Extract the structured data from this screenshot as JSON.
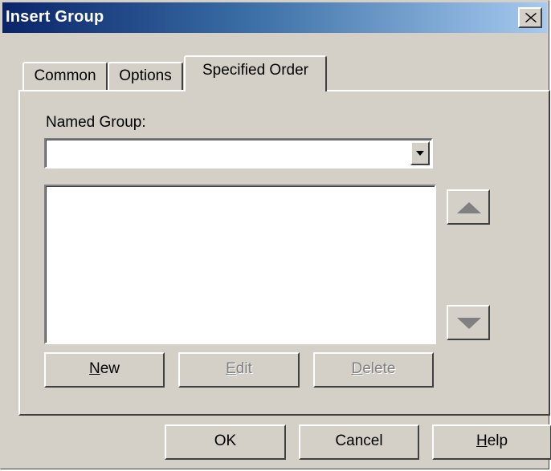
{
  "window": {
    "title": "Insert Group"
  },
  "tabs": [
    {
      "label": "Common",
      "active": false
    },
    {
      "label": "Options",
      "active": false
    },
    {
      "label": "Specified Order",
      "active": true
    }
  ],
  "specified_order": {
    "named_group_label": "Named Group:",
    "named_group_value": "",
    "list_items": [],
    "buttons": {
      "new": {
        "label": "New",
        "mnemonic": "N",
        "rest": "ew",
        "enabled": true
      },
      "edit": {
        "label": "Edit",
        "mnemonic": "E",
        "rest": "dit",
        "enabled": false
      },
      "delete": {
        "label": "Delete",
        "mnemonic": "D",
        "rest": "elete",
        "enabled": false
      }
    }
  },
  "footer": {
    "ok": {
      "label": "OK"
    },
    "cancel": {
      "label": "Cancel"
    },
    "help": {
      "label": "Help",
      "mnemonic": "H",
      "rest": "elp"
    }
  },
  "icons": {
    "close": "close-icon",
    "dropdown": "chevron-down-icon",
    "move_up": "arrow-up-icon",
    "move_down": "arrow-down-icon"
  },
  "colors": {
    "title_start": "#0a246a",
    "title_end": "#a6caf0",
    "face": "#d4d0c8",
    "disabled_text": "#808080"
  }
}
